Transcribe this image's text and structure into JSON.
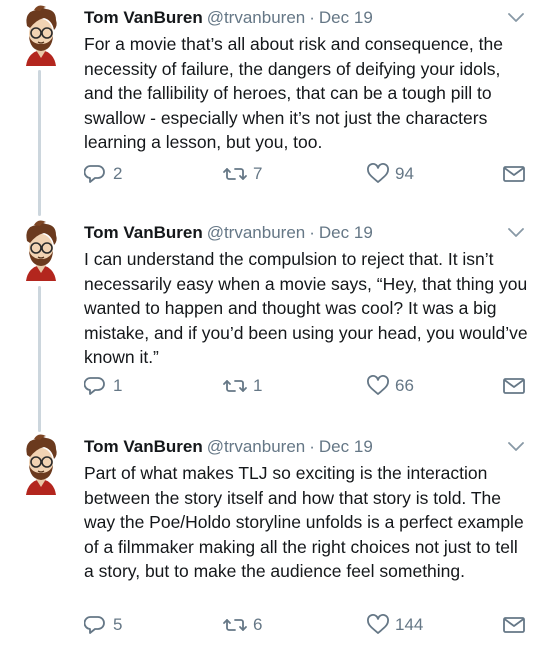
{
  "tweets": [
    {
      "name": "Tom VanBuren",
      "handle": "@trvanburen",
      "separator": "·",
      "date": "Dec 19",
      "text": "For a movie that’s all about risk and consequence, the necessity of failure, the dangers of deifying your idols, and the fallibility of heroes, that can be a tough pill to swallow - especially when it’s not just the characters learning a lesson, but you, too.",
      "replies": "2",
      "retweets": "7",
      "likes": "94"
    },
    {
      "name": "Tom VanBuren",
      "handle": "@trvanburen",
      "separator": "·",
      "date": "Dec 19",
      "text": "I can understand the compulsion to reject that. It isn’t necessarily easy when a movie says, “Hey, that thing you wanted to happen and thought was cool? It was a big mistake, and if you’d been using your head, you would’ve known it.”",
      "replies": "1",
      "retweets": "1",
      "likes": "66"
    },
    {
      "name": "Tom VanBuren",
      "handle": "@trvanburen",
      "separator": "·",
      "date": "Dec 19",
      "text": "Part of what makes TLJ so exciting is the interaction between the story itself and how that story is told. The way the Poe/Holdo storyline unfolds is a perfect example of a filmmaker making all the right choices not just to tell a story, but to make the audience feel something.",
      "replies": "5",
      "retweets": "6",
      "likes": "144"
    }
  ],
  "icons": {
    "reply": "reply-icon",
    "retweet": "retweet-icon",
    "like": "heart-icon",
    "dm": "envelope-icon",
    "menu": "chevron-down-icon"
  },
  "colors": {
    "text": "#14171a",
    "secondary": "#657786",
    "thread_line": "#ccd6dd"
  }
}
